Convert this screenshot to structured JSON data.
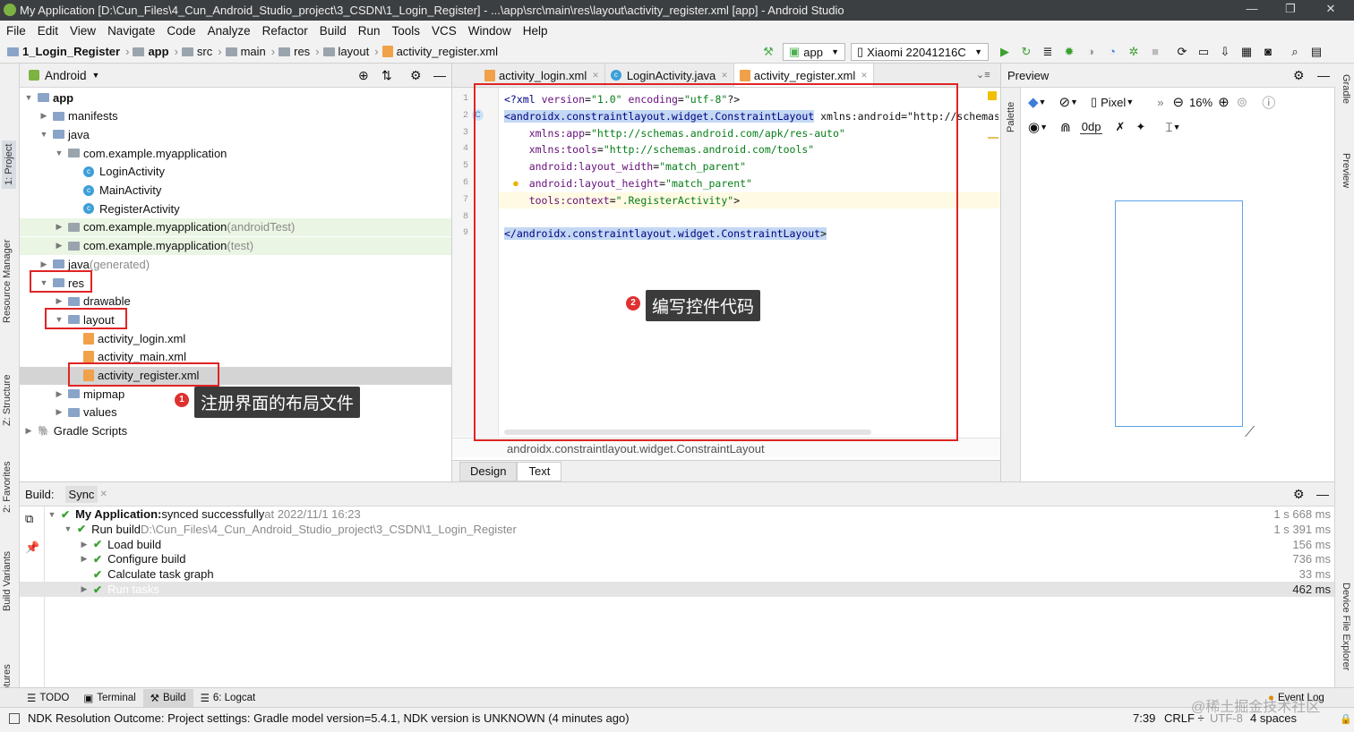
{
  "title_bar": {
    "title": "My Application [D:\\Cun_Files\\4_Cun_Android_Studio_project\\3_CSDN\\1_Login_Register] - ...\\app\\src\\main\\res\\layout\\activity_register.xml [app] - Android Studio",
    "minimize": "—",
    "maximize": "❐",
    "close": "✕"
  },
  "menu": [
    "File",
    "Edit",
    "View",
    "Navigate",
    "Code",
    "Analyze",
    "Refactor",
    "Build",
    "Run",
    "Tools",
    "VCS",
    "Window",
    "Help"
  ],
  "breadcrumb": [
    "1_Login_Register",
    "app",
    "src",
    "main",
    "res",
    "layout",
    "activity_register.xml"
  ],
  "toolbar": {
    "config": "app",
    "device": "Xiaomi 22041216C"
  },
  "left_strip": [
    "1: Project",
    "Resource Manager",
    "Z: Structure",
    "2: Favorites",
    "Build Variants",
    "Layout Captures"
  ],
  "right_strip": [
    "Gradle",
    "Preview",
    "Device File Explorer"
  ],
  "project_panel": {
    "view": "Android",
    "tree": [
      {
        "label": "app",
        "bold": true,
        "level": 0,
        "arrow": "▼",
        "icon": "folder"
      },
      {
        "label": "manifests",
        "level": 1,
        "arrow": "▶",
        "icon": "folder"
      },
      {
        "label": "java",
        "level": 1,
        "arrow": "▼",
        "icon": "folder"
      },
      {
        "label": "com.example.myapplication",
        "level": 2,
        "arrow": "▼",
        "icon": "package"
      },
      {
        "label": "LoginActivity",
        "level": 3,
        "arrow": "",
        "icon": "class"
      },
      {
        "label": "MainActivity",
        "level": 3,
        "arrow": "",
        "icon": "class"
      },
      {
        "label": "RegisterActivity",
        "level": 3,
        "arrow": "",
        "icon": "class"
      },
      {
        "label": "com.example.myapplication",
        "suffix": " (androidTest)",
        "level": 2,
        "arrow": "▶",
        "icon": "package",
        "tint": "green"
      },
      {
        "label": "com.example.myapplication",
        "suffix": " (test)",
        "level": 2,
        "arrow": "▶",
        "icon": "package",
        "tint": "green"
      },
      {
        "label": "java",
        "suffix": " (generated)",
        "level": 1,
        "arrow": "▶",
        "icon": "folder"
      },
      {
        "label": "res",
        "level": 1,
        "arrow": "▼",
        "icon": "folder"
      },
      {
        "label": "drawable",
        "level": 2,
        "arrow": "▶",
        "icon": "folder"
      },
      {
        "label": "layout",
        "level": 2,
        "arrow": "▼",
        "icon": "folder"
      },
      {
        "label": "activity_login.xml",
        "level": 3,
        "arrow": "",
        "icon": "xml"
      },
      {
        "label": "activity_main.xml",
        "level": 3,
        "arrow": "",
        "icon": "xml"
      },
      {
        "label": "activity_register.xml",
        "level": 3,
        "arrow": "",
        "icon": "xml",
        "selected": true
      },
      {
        "label": "mipmap",
        "level": 2,
        "arrow": "▶",
        "icon": "folder"
      },
      {
        "label": "values",
        "level": 2,
        "arrow": "▶",
        "icon": "folder"
      },
      {
        "label": "Gradle Scripts",
        "level": 0,
        "arrow": "▶",
        "icon": "gradle"
      }
    ]
  },
  "callout1": {
    "num": "1",
    "text": "注册界面的布局文件"
  },
  "callout2": {
    "num": "2",
    "text": "编写控件代码"
  },
  "editor": {
    "tabs": [
      {
        "label": "activity_login.xml"
      },
      {
        "label": "LoginActivity.java"
      },
      {
        "label": "activity_register.xml",
        "active": true
      }
    ],
    "line_numbers": [
      "1",
      "2",
      "3",
      "4",
      "5",
      "6",
      "7",
      "8",
      "9"
    ],
    "lines": [
      "<?xml version=\"1.0\" encoding=\"utf-8\"?>",
      "<androidx.constraintlayout.widget.ConstraintLayout xmlns:android=\"http://schemas.android",
      "    xmlns:app=\"http://schemas.android.com/apk/res-auto\"",
      "    xmlns:tools=\"http://schemas.android.com/tools\"",
      "    android:layout_width=\"match_parent\"",
      "    android:layout_height=\"match_parent\"",
      "    tools:context=\".RegisterActivity\">",
      "",
      "</androidx.constraintlayout.widget.ConstraintLayout>"
    ],
    "status_path": "androidx.constraintlayout.widget.ConstraintLayout",
    "mode_tabs": [
      "Design",
      "Text"
    ],
    "active_mode": "Text"
  },
  "preview": {
    "title": "Preview",
    "device": "Pixel",
    "zoom": "16%",
    "margin": "0dp",
    "side_label": "Palette"
  },
  "build": {
    "tabs": [
      "Build:",
      "Sync"
    ],
    "rows": [
      {
        "indent": 0,
        "arrow": "▼",
        "bold": "My Application:",
        "text": " synced successfully",
        "muted": " at 2022/11/1 16:23",
        "time": "1 s 668 ms"
      },
      {
        "indent": 1,
        "arrow": "▼",
        "bold": "",
        "text": "Run build",
        "muted": " D:\\Cun_Files\\4_Cun_Android_Studio_project\\3_CSDN\\1_Login_Register",
        "time": "1 s 391 ms"
      },
      {
        "indent": 2,
        "arrow": "▶",
        "bold": "",
        "text": "Load build",
        "muted": "",
        "time": "156 ms"
      },
      {
        "indent": 2,
        "arrow": "▶",
        "bold": "",
        "text": "Configure build",
        "muted": "",
        "time": "736 ms"
      },
      {
        "indent": 2,
        "arrow": "",
        "bold": "",
        "text": "Calculate task graph",
        "muted": "",
        "time": "33 ms"
      },
      {
        "indent": 2,
        "arrow": "▶",
        "bold": "",
        "text": "Run tasks",
        "muted": "",
        "time": "462 ms",
        "selected": true
      }
    ]
  },
  "bottom_tabs": [
    "TODO",
    "Terminal",
    "Build",
    "6: Logcat"
  ],
  "event_log": "Event Log",
  "status": {
    "message": "NDK Resolution Outcome: Project settings: Gradle model version=5.4.1, NDK version is UNKNOWN (4 minutes ago)",
    "position": "7:39",
    "line_sep": "CRLF ÷",
    "encoding": "UTF-8",
    "indent": "4 spaces"
  },
  "watermark": "@稀土掘金技术社区"
}
